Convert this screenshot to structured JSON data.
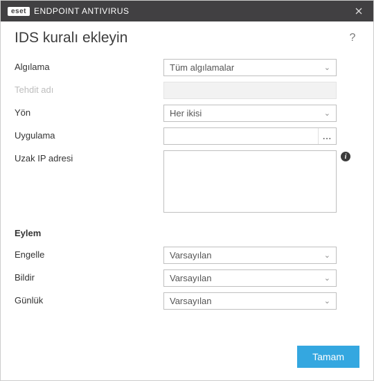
{
  "titlebar": {
    "brand": "eset",
    "product": "ENDPOINT ANTIVIRUS"
  },
  "page": {
    "title": "IDS kuralı ekleyin"
  },
  "form": {
    "detection": {
      "label": "Algılama",
      "value": "Tüm algılamalar"
    },
    "threatName": {
      "label": "Tehdit adı"
    },
    "direction": {
      "label": "Yön",
      "value": "Her ikisi"
    },
    "application": {
      "label": "Uygulama",
      "value": "",
      "browse": "..."
    },
    "remoteIp": {
      "label": "Uzak IP adresi",
      "value": ""
    }
  },
  "actionSection": {
    "title": "Eylem",
    "block": {
      "label": "Engelle",
      "value": "Varsayılan"
    },
    "notify": {
      "label": "Bildir",
      "value": "Varsayılan"
    },
    "log": {
      "label": "Günlük",
      "value": "Varsayılan"
    }
  },
  "footer": {
    "ok": "Tamam"
  }
}
